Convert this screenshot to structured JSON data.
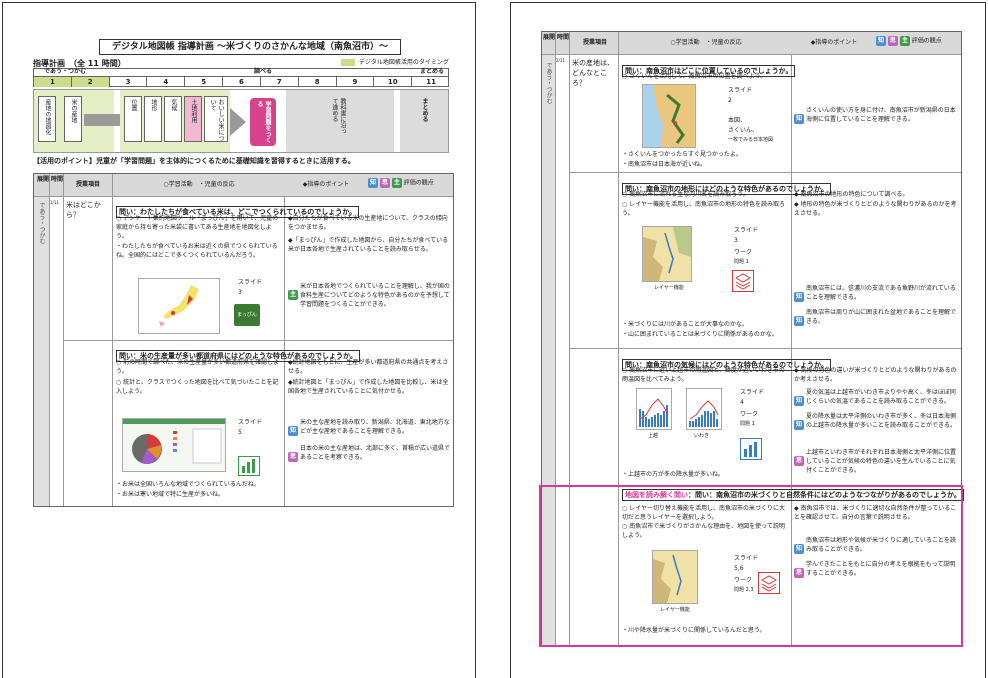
{
  "page1": {
    "title": "デジタル地図帳 指導計画 〜米づくりのさかんな地域（南魚沼市）〜",
    "plan_label": "指導計画　（全 11 時間）",
    "legend_label": "デジタル地図帳活用のタイミング",
    "phase_deau": "であう・つかむ",
    "phase_shiraberu": "調べる",
    "phase_matome": "まとめる",
    "hours": [
      "1",
      "2",
      "3",
      "4",
      "5",
      "6",
      "7",
      "8",
      "9",
      "10",
      "11"
    ],
    "flow_boxes": [
      "産地の地図化",
      "米の産地",
      "位置",
      "地形",
      "気候",
      "土地利用",
      "おいしい米について",
      "教科書に沿って進める",
      "まとめる"
    ],
    "flow_goal": "学習問題をつくる",
    "point": "【活用のポイント】児童が「学習問題」を主体的につくるために基礎知識を習得するときに活用する。",
    "table_headers": {
      "tenkai": "展開",
      "jikan": "時間",
      "koumoku": "授業項目",
      "katsudo": "○学習活動　・児童の反応",
      "shido": "◆指導のポイント",
      "hyoka": "評価の観点"
    },
    "badges": {
      "chi": "知",
      "shi": "思",
      "shu": "主"
    },
    "tenkai_text": "であう・つかむ",
    "row1": {
      "jikan": "1/11",
      "koumoku": "米はどこから？",
      "q1": "問い：わたしたちが食べている米は、どこでつくられているのでしょうか。",
      "act1": "○ アンケート集約地図ツール「まっぴん」を用いて、児童の家庭から持ち寄った米袋に書いてある生産地を地図化しよう。",
      "react1": "・わたしたちが食べているお米は近くの県でつくられているね。全国的にはどこで多くつくられているんだろう。",
      "slide1": "スライド",
      "slide1_no": "3",
      "mappin": "まっぴん",
      "pt1a": "◆自分たちが食べている米の生産地について、クラスの傾向をつかませる。",
      "pt1b": "◆「まっぴん」で作成した地図から、自分たちが食べている米が日本各地で生産されていることを読み取らせる。",
      "eval1": "米が日本各地でつくられていることを理解し、我が国の食料生産についてどのような特色があるのかを予想して学習問題をつくることができる。",
      "q2": "問い：米の生産量が多い都道府県にはどのような特色があるのでしょうか。",
      "act2a": "○ 前の時間で調べた、米の生産量が多い都道府県を確認しよう。",
      "act2b": "○ 統計と、クラスでつくった地図を比べて気づいたことを記入しよう。",
      "slide2": "スライド",
      "slide2_no": "5",
      "pt2a": "◆統計地図をもとに、生産が多い都道府県の共通点を考えさせる。",
      "pt2b": "◆統計地図と「まっぴん」で作成した地図を比較し、米は全国各地で生産されていることに気付かせる。",
      "eval2a": "米の主な産地を読み取り、新潟県、北海道、東北地方などが主な産地であることを理解できる。",
      "eval2b": "日本の米の主な産地は、北部に多く、首積が広い道県であることを考察できる。",
      "react2a": "・お米は全国いろんな地域でつくられているんだね。",
      "react2b": "・お米は寒い地域で特に生産が多いね。"
    }
  },
  "page2": {
    "tenkai_text": "であう・つかむ",
    "row_jikan": "2/11",
    "koumoku": "米の産地は、どんなところ？",
    "q1": "問い：南魚沼市はどこに位置しているのでしょうか。",
    "act1": "○ さくいんを活用して、南魚沼市の位置を調べよう。",
    "slide1": "スライド",
    "slide1_no": "2",
    "slide1_note1": "本図、",
    "slide1_note2": "さくいん、",
    "slide1_note3": "一枚でみる日本地図",
    "react1a": "・さくいんをつかったらすぐ見つかったよ。",
    "react1b": "・南魚沼市は日本海が近いね。",
    "eval1": "さくいんの使い方を身に付け、南魚沼市が新潟県の日本海側に位置していることを理解できる。",
    "q2": "問い：南魚沼市の地形にはどのような特色があるのでしょうか。",
    "act2a": "○ 南魚沼市に流れる主な河川名を読み取ろう。",
    "act2b": "○ レイヤー機能を活用し、南魚沼市の地形の特色を読み取ろう。",
    "slide2": "スライド",
    "slide2_no": "3",
    "work2": "ワーク",
    "work2_no": "問題 1",
    "layer2": "レイヤー機能",
    "react2a": "・米づくりには川があることが大事なのかな。",
    "react2b": "・山に囲まれていることは米づくりに関係があるのかな。",
    "pt2a": "◆ 南魚沼市の地形の特色について調べる。",
    "pt2b": "◆ 地形の特色が米づくりとどのような関わりがあるのかを考えさせる。",
    "eval2a": "南魚沼市には、信濃川の支流である魚野川が流れていることを理解できる。",
    "eval2b": "南魚沼市は周りが山に囲まれた盆地であることを理解できる。",
    "q3": "問い：南魚沼市の気候にはどのような特色があるのでしょうか。",
    "act3": "○ 南魚沼市に近い上越市の雨温図と、緯度が近いいわき市の雨温図を比べてみよう。",
    "slide3": "スライド",
    "slide3_no": "4",
    "work3": "ワーク",
    "work3_no": "問題 1",
    "city_a": "上越",
    "city_b": "いわき",
    "react3": "・上越市の方が冬の降水量が多いね。",
    "pt3": "◆ 気候の特色の違いが米づくりとどのような関わりがあるのか考えさせる。",
    "eval3a": "夏の気温は上越市がいわき市よりやや高く、冬はほぼ同じくらいの気温であることを読み取ることができる。",
    "eval3b": "夏の降水量は太平洋側のいわき市が多く、冬は日本海側の上越市の降水量が多いことを読み取ることができる。",
    "eval3c": "上越市といわき市がそれぞれ日本海側と太平洋側に位置していることが気候の特色の違いを生んでいることに気付くことができる。",
    "q4_tag": "地図を読み解く問い",
    "q4": "：問い：南魚沼市の米づくりと自然条件にはどのようなつながりがあるのでしょうか。",
    "act4a": "○ レイヤー切り替え機能を活用し、南魚沼市の米づくりに大切だと思うレイヤーを選択しよう。",
    "act4b": "○ 南魚沼市で米づくりがさかんな理由を、地図を使って説明しよう。",
    "slide4": "スライド",
    "slide4_no": "5,6",
    "work4": "ワーク",
    "work4_no": "問題 2,3",
    "layer4": "レイヤー機能",
    "react4": "・川や降水量が米づくりに関係しているんだと思う。",
    "pt4": "◆ 南魚沼市では、米づくりに適切な自然条件が整っていることを確認させて、自分の言葉で説明させる。",
    "eval4a": "南魚沼市は地形や気候が米づくりに適していることを読み取ることができる。",
    "eval4b": "学んできたことをもとに自分の考えを根拠をもって説明することができる。"
  },
  "colors": {
    "accent_green": "#c9de8c",
    "goal_pink": "#d6438a",
    "frame_magenta": "#d43a9a",
    "chi": "#4f8fd1",
    "shi": "#c066b8",
    "shu": "#3d9b4c"
  }
}
